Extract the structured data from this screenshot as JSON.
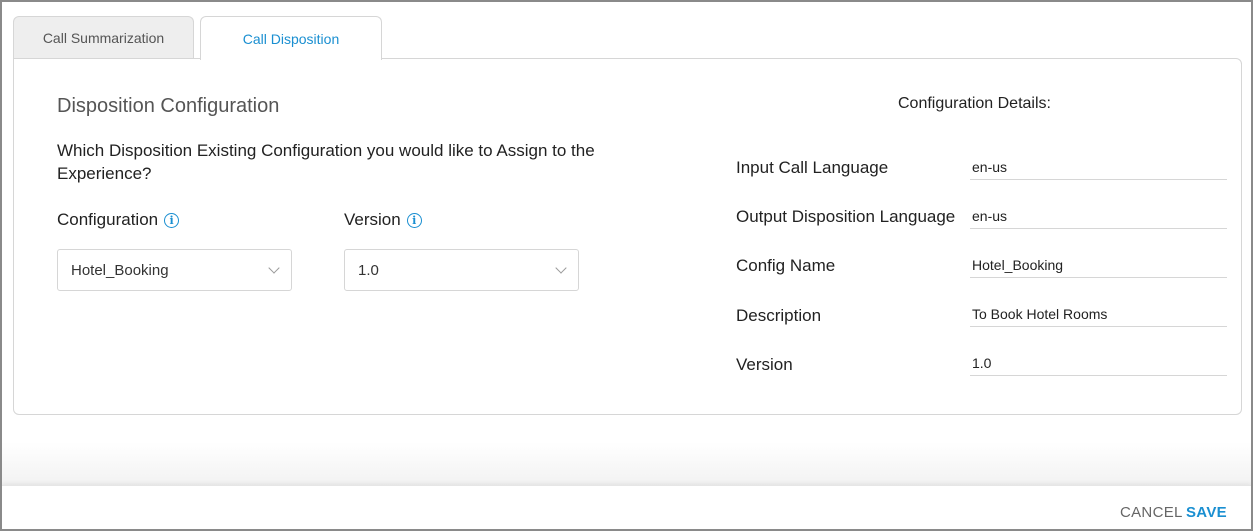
{
  "tabs": [
    {
      "label": "Call Summarization",
      "active": false
    },
    {
      "label": "Call Disposition",
      "active": true
    }
  ],
  "form": {
    "title": "Disposition Configuration",
    "question": "Which Disposition Existing Configuration you would like to Assign to the Experience?",
    "configuration": {
      "label": "Configuration",
      "value": "Hotel_Booking",
      "info_icon": "info-icon"
    },
    "version": {
      "label": "Version",
      "value": "1.0",
      "info_icon": "info-icon"
    }
  },
  "details": {
    "title": "Configuration Details:",
    "rows": [
      {
        "label": "Input Call Language",
        "value": "en-us"
      },
      {
        "label": "Output Disposition Language",
        "value": "en-us"
      },
      {
        "label": "Config Name",
        "value": "Hotel_Booking"
      },
      {
        "label": "Description",
        "value": "To Book Hotel Rooms"
      },
      {
        "label": "Version",
        "value": "1.0"
      }
    ]
  },
  "footer": {
    "cancel_label": "CANCEL",
    "save_label": "SAVE"
  },
  "colors": {
    "accent": "#1a8fd1",
    "border": "#d6d6d6",
    "title": "#555555"
  }
}
